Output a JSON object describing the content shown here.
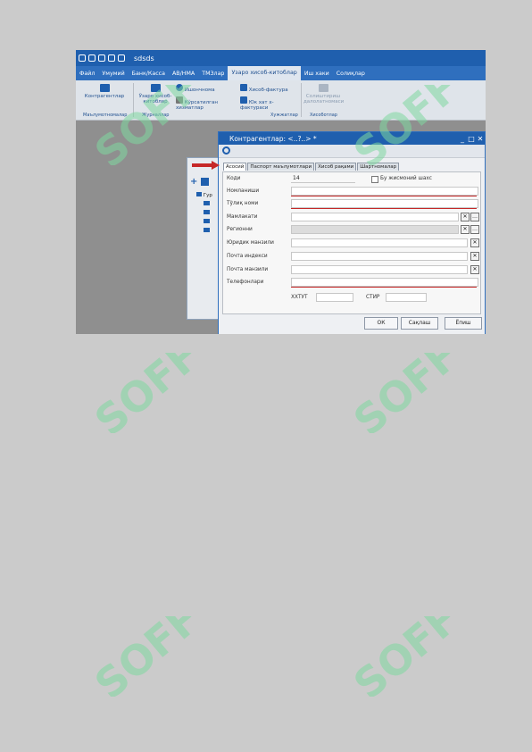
{
  "app": {
    "title": "sdsds",
    "menu": [
      "Файл",
      "Умумий",
      "Банк/Касса",
      "АВ/НМА",
      "ТМЗлар",
      "Узаро хисоб-китоблар",
      "Иш хаки",
      "Солиқлар"
    ],
    "active_menu_index": 5
  },
  "ribbon": {
    "buttons": [
      "Контрагентлар",
      "Ўзаро хисоб-китоблар",
      "Ишончнома",
      "Кўрсатилган хизматлар",
      "Хисоб-фактура",
      "Юк хат х-фактураси",
      "Солиштириш далолатномаси"
    ],
    "groups": [
      "Маълумотномалар",
      "Журналлар",
      "Хужжатлар",
      "Хисоботлар"
    ]
  },
  "left_panel": {
    "tree_label": "Гур"
  },
  "dialog": {
    "title": "Контрагентлар: <..?..>",
    "title_suffix": "*",
    "tabs": [
      "Асосий",
      "Паспорт маълумотлари",
      "Хисоб рақами",
      "Шартномалар"
    ],
    "active_tab_index": 0,
    "fields": {
      "code_label": "Коди",
      "code_value": "14",
      "individual_label": "Бу жисмоний шахс",
      "company_label": "Номланиши",
      "fullname_label": "Тўлиқ номи",
      "region_label": "Мамлакати",
      "district_label": "Регионни",
      "legal_address_label": "Юридик манзили",
      "postal_index_label": "Почта индекси",
      "postal_address_label": "Почта манзили",
      "phones_label": "Телефонлари",
      "okonh_label": "ХХТУТ",
      "inn_label": "СТИР"
    },
    "buttons": {
      "ok": "ОК",
      "save": "Сақлаш",
      "close": "Ёпиш"
    }
  },
  "watermark": {
    "text": "SOFF"
  },
  "colors": {
    "accent": "#1f5fae",
    "watermark_green": "#7fd8a0",
    "error_red": "#c62828"
  }
}
